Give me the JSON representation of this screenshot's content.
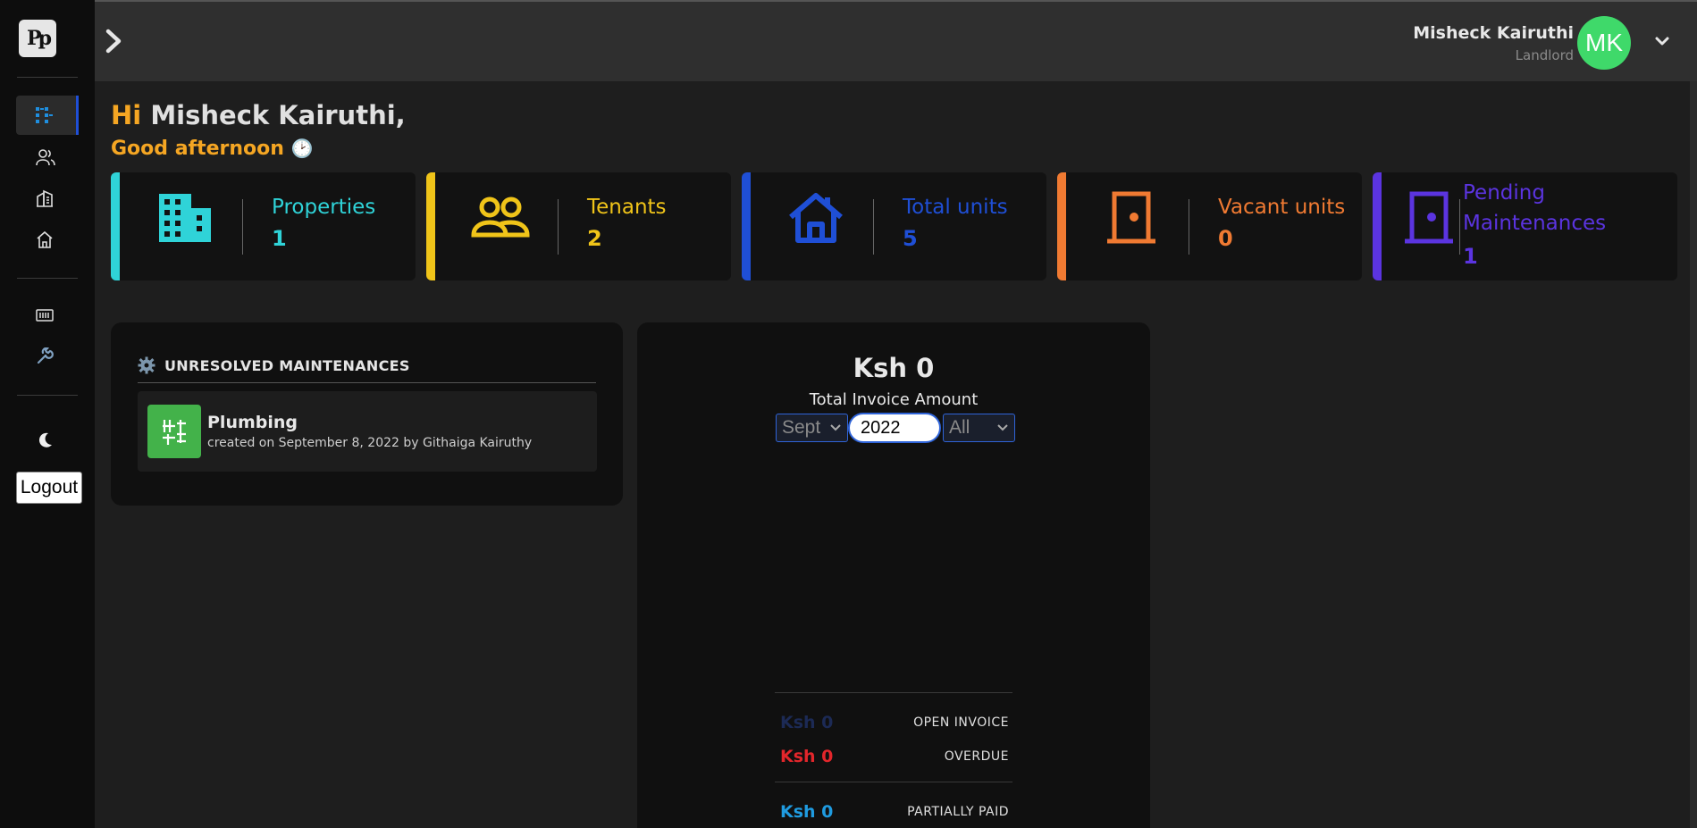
{
  "app": {
    "logo_text": "Pp"
  },
  "sidebar": {
    "items": [
      {
        "name": "dashboard-icon",
        "active": true
      },
      {
        "name": "users-icon",
        "active": false
      },
      {
        "name": "buildings-icon",
        "active": false
      },
      {
        "name": "home-icon",
        "active": false
      },
      {
        "name": "invoice-icon",
        "active": false
      },
      {
        "name": "wrench-icon",
        "active": false
      },
      {
        "name": "moon-icon",
        "active": false
      }
    ],
    "logout_label": "Logout"
  },
  "topbar": {
    "user_name": "Misheck Kairuthi",
    "user_role": "Landlord",
    "avatar_initials": "MK",
    "avatar_color": "#3fd96a"
  },
  "greeting": {
    "hi": "Hi",
    "name": "Misheck Kairuthi,",
    "time_of_day": "Good afternoon",
    "clock_icon": "🕑"
  },
  "stats": [
    {
      "label": "Properties",
      "value": "1",
      "color": "#2fd3d8",
      "icon": "building-icon"
    },
    {
      "label": "Tenants",
      "value": "2",
      "color": "#f0c419",
      "icon": "people-icon"
    },
    {
      "label": "Total units",
      "value": "5",
      "color": "#1f4fd6",
      "icon": "house-icon"
    },
    {
      "label": "Vacant units",
      "value": "0",
      "color": "#f07a32",
      "icon": "door-icon"
    },
    {
      "label": "Pending Maintenances",
      "value": "1",
      "color": "#5b34e0",
      "icon": "door-icon"
    }
  ],
  "maintenances": {
    "title": "UNRESOLVED MAINTENANCES",
    "items": [
      {
        "title": "Plumbing",
        "subtitle": "created on September 8, 2022 by Githaiga Kairuthy"
      }
    ]
  },
  "invoice": {
    "total": "Ksh 0",
    "total_label": "Total Invoice Amount",
    "month": "Sept",
    "year": "2022",
    "filter": "All",
    "statuses": [
      {
        "amount": "Ksh 0",
        "label": "OPEN INVOICE",
        "color": "#1c2a55"
      },
      {
        "amount": "Ksh 0",
        "label": "OVERDUE",
        "color": "#e3262b"
      },
      {
        "amount": "Ksh 0",
        "label": "PARTIALLY PAID",
        "color": "#1f9be0"
      }
    ]
  }
}
